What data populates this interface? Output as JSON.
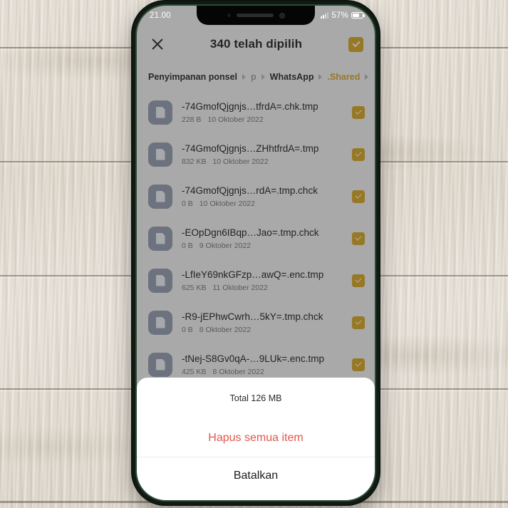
{
  "statusbar": {
    "time": "21.00",
    "battery_percent": "57%",
    "signal_icon": "signal-bars-icon",
    "battery_icon": "battery-icon"
  },
  "appbar": {
    "close_icon": "close-icon",
    "title": "340 telah dipilih",
    "select_all_icon": "checkbox-checked-icon"
  },
  "breadcrumb": {
    "separator_icon": "chevron-right-icon",
    "items": [
      {
        "label": "Penyimpanan ponsel",
        "state": "normal"
      },
      {
        "label": "p",
        "state": "faded"
      },
      {
        "label": "WhatsApp",
        "state": "normal"
      },
      {
        "label": ".Shared",
        "state": "active"
      }
    ]
  },
  "files": [
    {
      "name": "-74GmofQjgnjs…tfrdA=.chk.tmp",
      "size": "228 B",
      "date": "10 Oktober 2022",
      "selected": true,
      "icon": "file-document-icon"
    },
    {
      "name": "-74GmofQjgnjs…ZHhtfrdA=.tmp",
      "size": "832 KB",
      "date": "10 Oktober 2022",
      "selected": true,
      "icon": "file-document-icon"
    },
    {
      "name": "-74GmofQjgnjs…rdA=.tmp.chck",
      "size": "0 B",
      "date": "10 Oktober 2022",
      "selected": true,
      "icon": "file-document-icon"
    },
    {
      "name": "-EOpDgn6IBqp…Jao=.tmp.chck",
      "size": "0 B",
      "date": "9 Oktober 2022",
      "selected": true,
      "icon": "file-document-icon"
    },
    {
      "name": "-LfIeY69nkGFzp…awQ=.enc.tmp",
      "size": "625 KB",
      "date": "11 Oktober 2022",
      "selected": true,
      "icon": "file-document-icon"
    },
    {
      "name": "-R9-jEPhwCwrh…5kY=.tmp.chck",
      "size": "0 B",
      "date": "8 Oktober 2022",
      "selected": true,
      "icon": "file-document-icon"
    },
    {
      "name": "-tNej-S8Gv0qA-…9LUk=.enc.tmp",
      "size": "425 KB",
      "date": "8 Oktober 2022",
      "selected": true,
      "icon": "file-document-icon"
    }
  ],
  "sheet": {
    "total_label": "Total 126 MB",
    "delete_label": "Hapus semua item",
    "cancel_label": "Batalkan"
  },
  "colors": {
    "accent": "#d4a017",
    "danger": "#e2574c",
    "file_icon": "#8e96ac",
    "app_background": "#f2f2f2",
    "sheet_background": "#ffffff"
  }
}
